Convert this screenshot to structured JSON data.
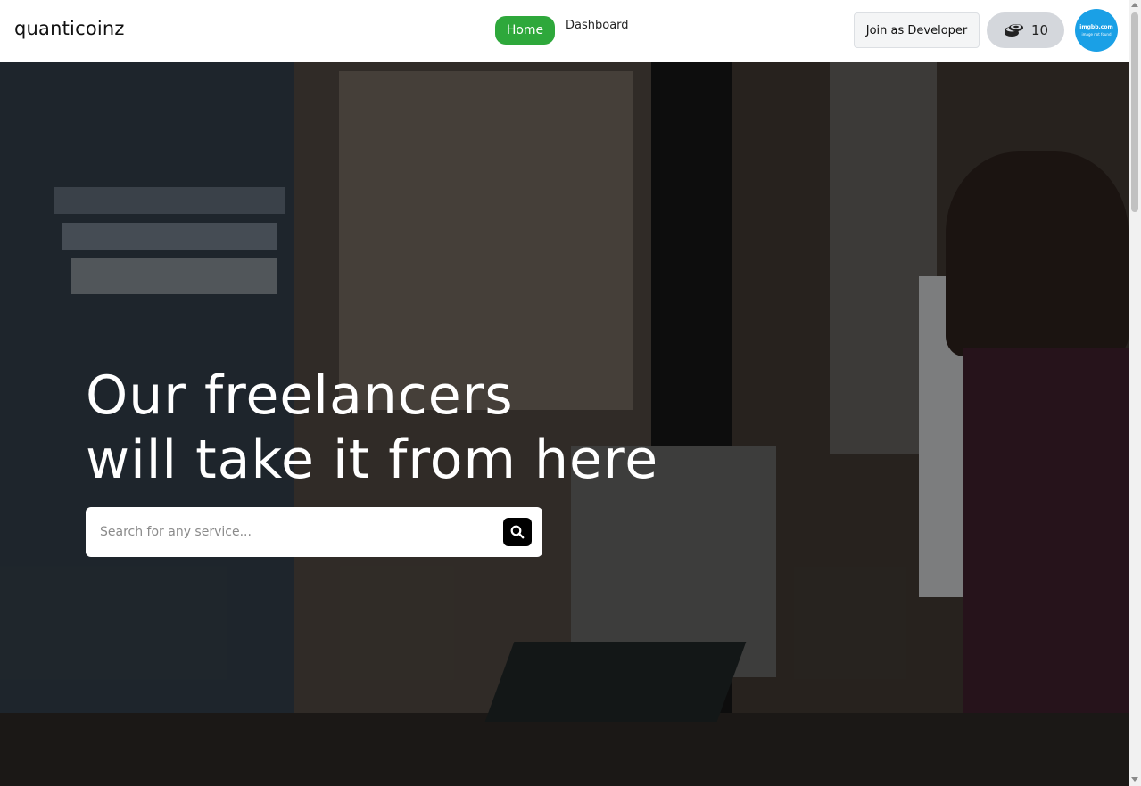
{
  "navbar": {
    "brand": "quanticoinz",
    "links": [
      {
        "label": "Home",
        "active": true
      },
      {
        "label": "Dashboard",
        "active": false
      }
    ],
    "join_button": "Join as Developer",
    "coin_count": "10",
    "avatar_line1": "imgbb.com",
    "avatar_line2": "image not found"
  },
  "hero": {
    "headline_line1": "Our freelancers",
    "headline_line2": "will take it from here",
    "search_placeholder": "Search for any service..."
  },
  "colors": {
    "accent_green": "#2ea83b",
    "avatar_blue": "#1aa0e6",
    "search_button": "#000000"
  },
  "icons": [
    "coins-icon",
    "search-icon"
  ]
}
